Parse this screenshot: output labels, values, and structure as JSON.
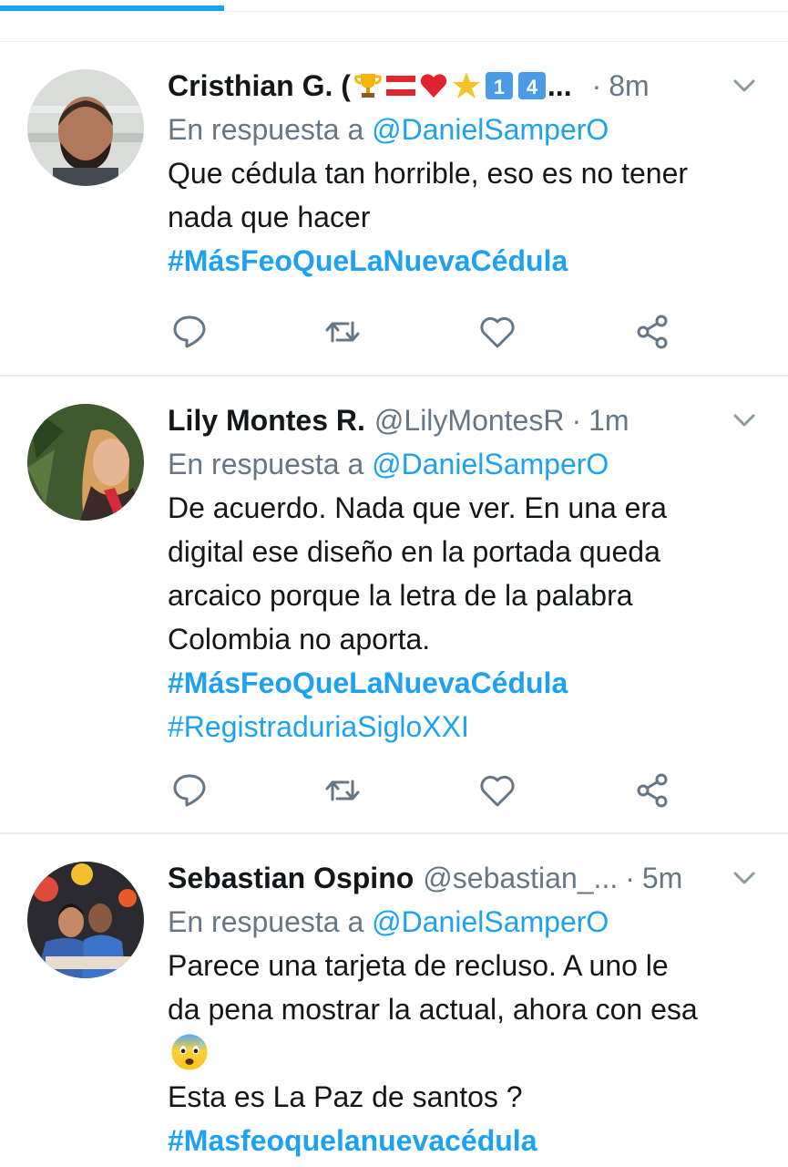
{
  "tweets": [
    {
      "name": "Cristhian G. (",
      "name_emojis": [
        "trophy",
        "austria-flag",
        "red-heart",
        "star",
        "keycap-1",
        "keycap-4"
      ],
      "name_ellipsis": "...",
      "handle": "",
      "separator": "·",
      "time": "8m",
      "reply_prefix": "En respuesta a",
      "reply_mention": "@DanielSamperO",
      "lines": [
        "Que cédula tan horrible, eso es no tener",
        "nada que hacer"
      ],
      "hashtags": [
        "#MásFeoQueLaNuevaCédula"
      ]
    },
    {
      "name": "Lily Montes R.",
      "handle": "@LilyMontesR",
      "separator": "·",
      "time": "1m",
      "reply_prefix": "En respuesta a",
      "reply_mention": "@DanielSamperO",
      "lines": [
        "De acuerdo. Nada que ver. En una era",
        "digital ese diseño en la portada queda",
        "arcaico porque la letra de la palabra",
        "Colombia no aporta."
      ],
      "hashtags": [
        "#MásFeoQueLaNuevaCédula",
        "#RegistraduriaSigloXXI"
      ]
    },
    {
      "name": "Sebastian Ospino",
      "handle": "@sebastian_...",
      "separator": "·",
      "time": "5m",
      "reply_prefix": "En respuesta a",
      "reply_mention": "@DanielSamperO",
      "lines": [
        "Parece una tarjeta de recluso. A uno le",
        "da pena mostrar la actual, ahora con esa"
      ],
      "emoji_line": "anxious-face-emoji",
      "lines2": [
        "Esta es La Paz de santos ?"
      ],
      "hashtags": [
        "#Masfeoquelanuevacédula"
      ]
    }
  ],
  "colors": {
    "accent": "#1da1f2",
    "muted": "#657786",
    "text": "#14171a",
    "divider": "#e6ecf0"
  },
  "action_icons": [
    "reply-icon",
    "retweet-icon",
    "like-icon",
    "share-icon"
  ]
}
